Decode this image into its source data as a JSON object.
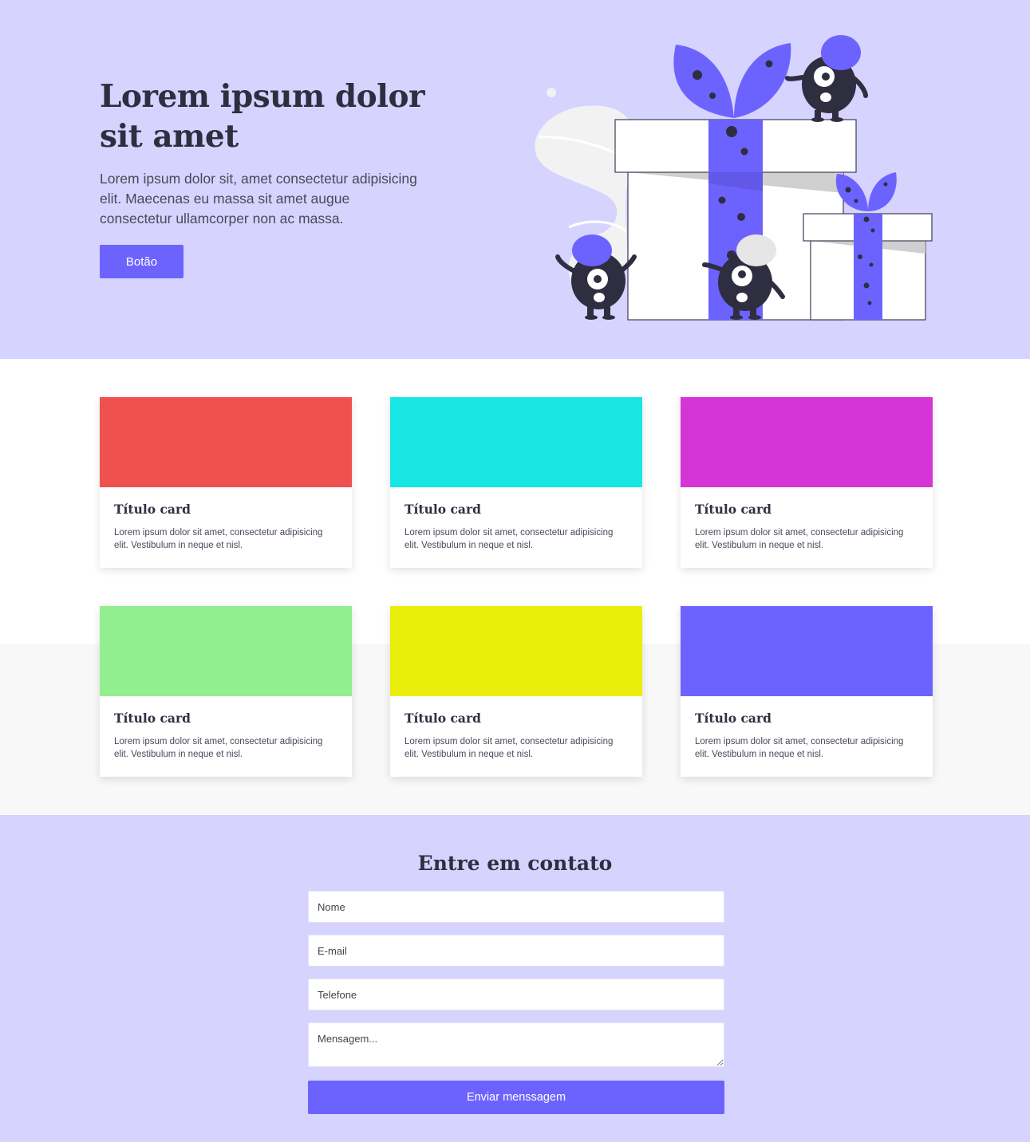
{
  "hero": {
    "title": "Lorem ipsum dolor sit amet",
    "text": "Lorem ipsum dolor sit, amet consectetur adipisicing elit. Maecenas eu massa sit amet augue consectetur ullamcorper non ac massa.",
    "button_label": "Botão",
    "illustration": "gift-boxes-monsters-illustration"
  },
  "colors": {
    "accent": "#6c63ff",
    "hero_bg": "#d6d3fe",
    "text_dark": "#2f2e41"
  },
  "cards": [
    {
      "title": "Título card",
      "text": "Lorem ipsum dolor sit amet, consectetur adipisicing elit. Vestibulum in neque et nisl.",
      "color": "#ef5050"
    },
    {
      "title": "Título card",
      "text": "Lorem ipsum dolor sit amet, consectetur adipisicing elit. Vestibulum in neque et nisl.",
      "color": "#18e6e3"
    },
    {
      "title": "Título card",
      "text": "Lorem ipsum dolor sit amet, consectetur adipisicing elit. Vestibulum in neque et nisl.",
      "color": "#d535d4"
    },
    {
      "title": "Título card",
      "text": "Lorem ipsum dolor sit amet, consectetur adipisicing elit. Vestibulum in neque et nisl.",
      "color": "#92ef8f"
    },
    {
      "title": "Título card",
      "text": "Lorem ipsum dolor sit amet, consectetur adipisicing elit. Vestibulum in neque et nisl.",
      "color": "#ebed0b"
    },
    {
      "title": "Título card",
      "text": "Lorem ipsum dolor sit amet, consectetur adipisicing elit. Vestibulum in neque et nisl.",
      "color": "#6c63ff"
    }
  ],
  "contact": {
    "title": "Entre em contato",
    "name_placeholder": "Nome",
    "email_placeholder": "E-mail",
    "phone_placeholder": "Telefone",
    "message_placeholder": "Mensagem...",
    "submit_label": "Enviar menssagem"
  }
}
